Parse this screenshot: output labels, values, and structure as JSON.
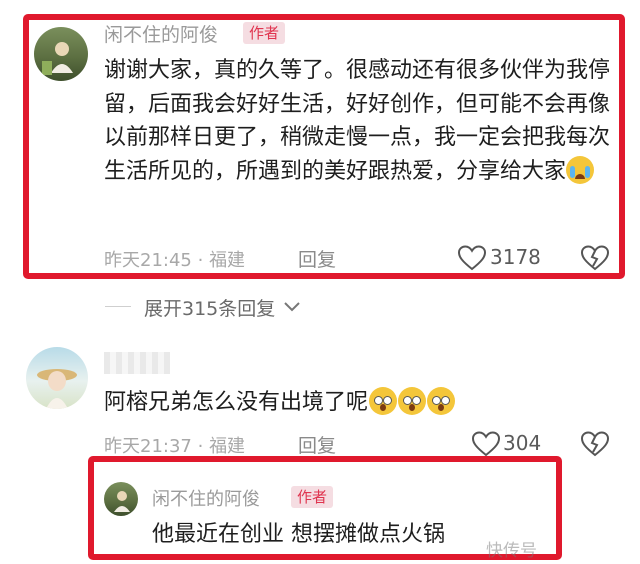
{
  "comment1": {
    "username": "闲不住的阿俊",
    "badge": "作者",
    "text": "谢谢大家，真的久等了。很感动还有很多伙伴为我停留，后面我会好好生活，好好创作，但可能不会再像以前那样日更了，稍微走慢一点，我一定会把我每次生活所见的，所遇到的美好跟热爱，分享给大家",
    "emoji": "crying-face",
    "time": "昨天21:45",
    "location": "福建",
    "reply_label": "回复",
    "likes": "3178"
  },
  "expand_replies": {
    "label": "展开315条回复"
  },
  "comment2": {
    "username": "",
    "text": "阿榕兄弟怎么没有出境了呢",
    "emojis": [
      "astonished-face",
      "astonished-face",
      "astonished-face"
    ],
    "time": "昨天21:37",
    "location": "福建",
    "reply_label": "回复",
    "likes": "304"
  },
  "reply1": {
    "username": "闲不住的阿俊",
    "badge": "作者",
    "text": "他最近在创业 想摆摊做点火锅"
  },
  "watermark": "快传号",
  "colors": {
    "highlight_border": "#e0192d",
    "badge_bg": "#f5dde2",
    "badge_text": "#e0344f",
    "meta_text": "#a8a8a8"
  }
}
